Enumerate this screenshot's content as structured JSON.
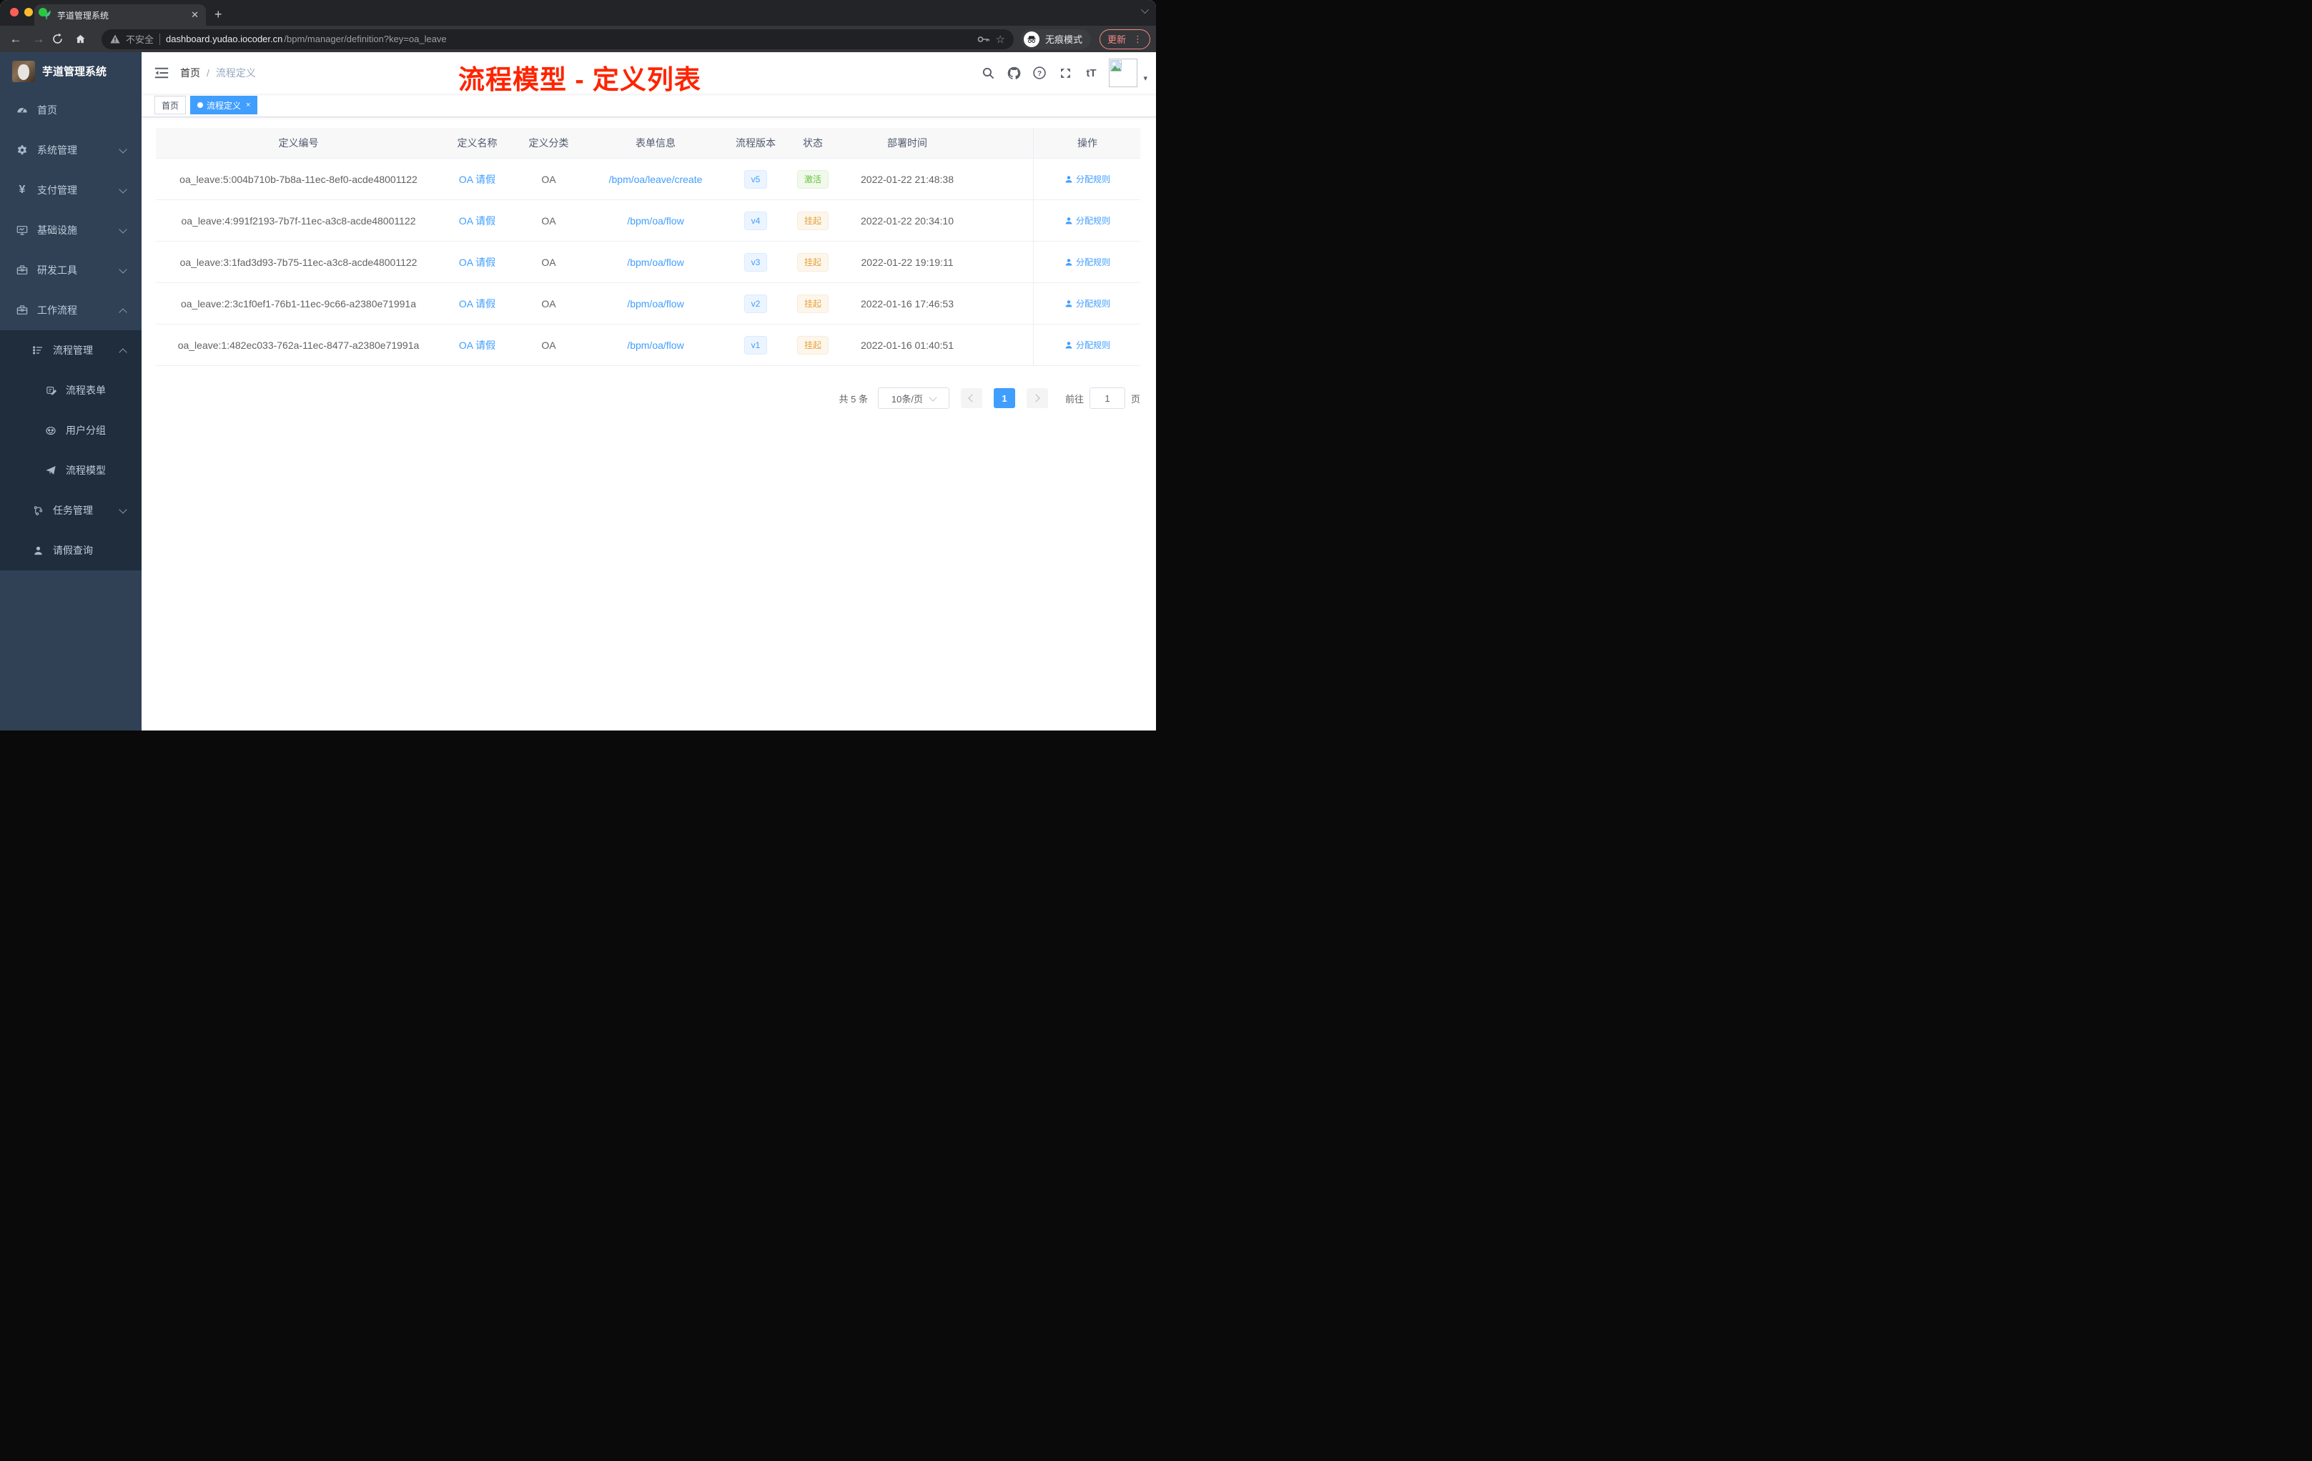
{
  "theme": {
    "accent": "#409eff",
    "red-annotation": "#ff2400",
    "sidebar-bg": "#304156",
    "sidebar-sub-bg": "#1f2d3d",
    "sidebar-text": "#bfcbd9",
    "chrome-strip": "#222427",
    "chrome-toolbar": "#35363a",
    "chrome-pill": "#202124",
    "update-red": "#f28b82",
    "badge-blue-bg": "#ecf5ff",
    "badge-blue-text": "#409eff",
    "badge-green-bg": "#f0f9eb",
    "badge-green-text": "#67c23a",
    "badge-orange-bg": "#fdf6ec",
    "badge-orange-text": "#e6a23c",
    "traffic-red": "#ff5f57",
    "traffic-yellow": "#febc2e",
    "traffic-green": "#28c840"
  },
  "browser": {
    "tab_title": "芋道管理系统",
    "new_tab": "+",
    "close_tab": "✕",
    "security_label": "不安全",
    "url_host": "dashboard.yudao.iocoder.cn",
    "url_path": "/bpm/manager/definition?key=oa_leave",
    "incognito_label": "无痕模式",
    "update_label": "更新",
    "kebab": "⋮",
    "back": "←",
    "forward": "→"
  },
  "sidebar": {
    "logo_title": "芋道管理系统",
    "items": [
      {
        "label": "首页"
      },
      {
        "label": "系统管理"
      },
      {
        "label": "支付管理"
      },
      {
        "label": "基础设施"
      },
      {
        "label": "研发工具"
      },
      {
        "label": "工作流程"
      },
      {
        "label": "流程管理"
      },
      {
        "label": "流程表单"
      },
      {
        "label": "用户分组"
      },
      {
        "label": "流程模型"
      },
      {
        "label": "任务管理"
      },
      {
        "label": "请假查询"
      }
    ]
  },
  "header": {
    "breadcrumb": {
      "home": "首页",
      "separator": "/",
      "current": "流程定义"
    },
    "annotation": "流程模型 - 定义列表",
    "font_size_label": "tT",
    "avatar_caret": "▾"
  },
  "tags": {
    "items": [
      {
        "label": "首页"
      },
      {
        "label": "流程定义",
        "close": "×"
      }
    ]
  },
  "table": {
    "columns": [
      "定义编号",
      "定义名称",
      "定义分类",
      "表单信息",
      "流程版本",
      "状态",
      "部署时间",
      "操作"
    ],
    "rows": [
      {
        "id": "oa_leave:5:004b710b-7b8a-11ec-8ef0-acde48001122",
        "name": "OA 请假",
        "category": "OA",
        "form": "/bpm/oa/leave/create",
        "version": "v5",
        "status": "激活",
        "deploy_time": "2022-01-22 21:48:38",
        "action": "分配规则"
      },
      {
        "id": "oa_leave:4:991f2193-7b7f-11ec-a3c8-acde48001122",
        "name": "OA 请假",
        "category": "OA",
        "form": "/bpm/oa/flow",
        "version": "v4",
        "status": "挂起",
        "deploy_time": "2022-01-22 20:34:10",
        "action": "分配规则"
      },
      {
        "id": "oa_leave:3:1fad3d93-7b75-11ec-a3c8-acde48001122",
        "name": "OA 请假",
        "category": "OA",
        "form": "/bpm/oa/flow",
        "version": "v3",
        "status": "挂起",
        "deploy_time": "2022-01-22 19:19:11",
        "action": "分配规则"
      },
      {
        "id": "oa_leave:2:3c1f0ef1-76b1-11ec-9c66-a2380e71991a",
        "name": "OA 请假",
        "category": "OA",
        "form": "/bpm/oa/flow",
        "version": "v2",
        "status": "挂起",
        "deploy_time": "2022-01-16 17:46:53",
        "action": "分配规则"
      },
      {
        "id": "oa_leave:1:482ec033-762a-11ec-8477-a2380e71991a",
        "name": "OA 请假",
        "category": "OA",
        "form": "/bpm/oa/flow",
        "version": "v1",
        "status": "挂起",
        "deploy_time": "2022-01-16 01:40:51",
        "action": "分配规则"
      }
    ]
  },
  "pagination": {
    "total": "共 5 条",
    "page_size": "10条/页",
    "current_page": "1",
    "goto_label": "前往",
    "goto_value": "1",
    "page_suffix": "页"
  }
}
